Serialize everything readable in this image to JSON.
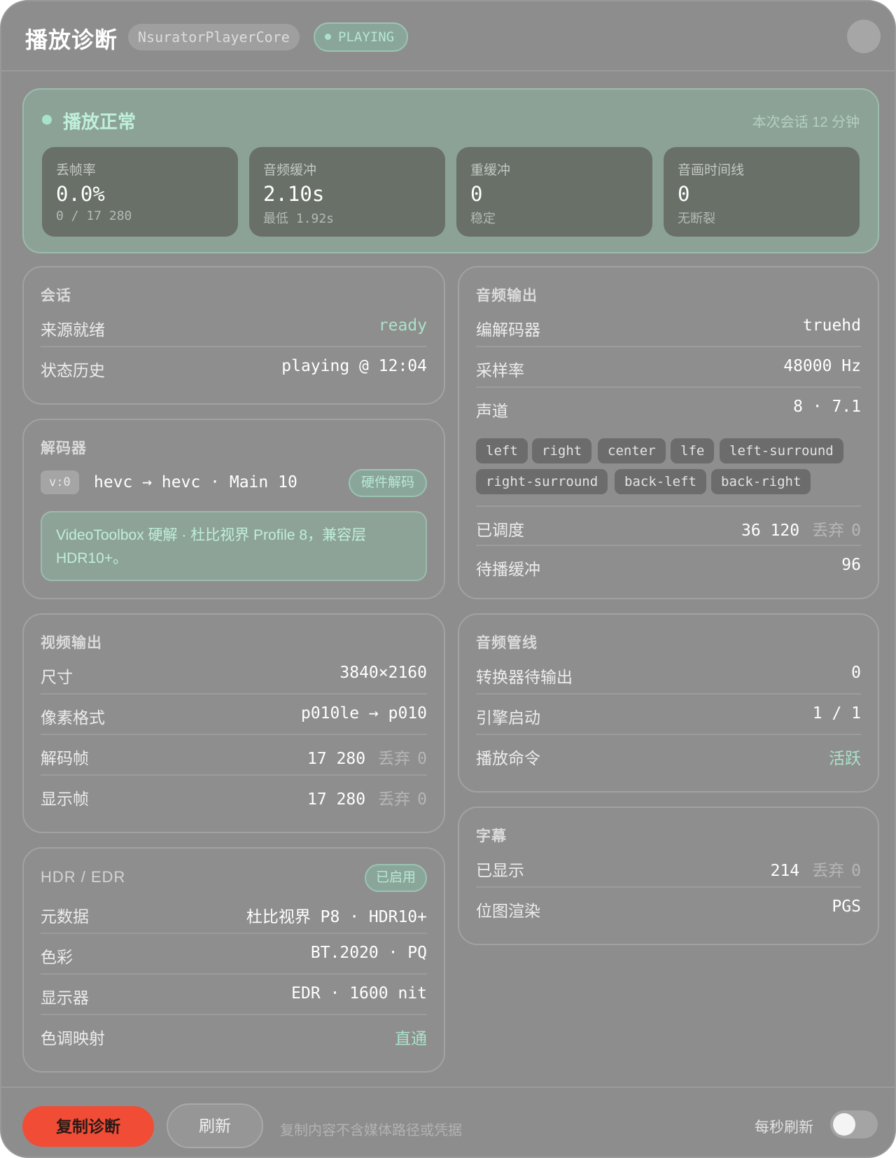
{
  "header": {
    "title": "播放诊断",
    "core": "NsuratorPlayerCore",
    "state": "PLAYING"
  },
  "status": {
    "title": "播放正常",
    "session": "本次会话 12 分钟",
    "metrics": [
      {
        "label": "丢帧率",
        "value": "0.0%",
        "sub": "0 / 17 280"
      },
      {
        "label": "音频缓冲",
        "value": "2.10s",
        "sub": "最低 1.92s"
      },
      {
        "label": "重缓冲",
        "value": "0",
        "sub": "稳定"
      },
      {
        "label": "音画时间线",
        "value": "0",
        "sub": "无断裂"
      }
    ]
  },
  "session": {
    "heading": "会话",
    "rows": [
      {
        "key": "来源就绪",
        "value": "ready"
      },
      {
        "key": "状态历史",
        "value": "playing @ 12:04"
      }
    ]
  },
  "decoder": {
    "heading": "解码器",
    "track": "v:0",
    "codec_line": "hevc → hevc · Main 10",
    "hw_label": "硬件解码",
    "note": "VideoToolbox 硬解 · 杜比视界 Profile 8，兼容层 HDR10+。"
  },
  "video_out": {
    "heading": "视频输出",
    "drop_label": "丢弃",
    "rows": [
      {
        "key": "尺寸",
        "value": "3840×2160"
      },
      {
        "key": "像素格式",
        "value": "p010le → p010"
      },
      {
        "key": "解码帧",
        "value": "17 280",
        "dropped": "0"
      },
      {
        "key": "显示帧",
        "value": "17 280",
        "dropped": "0"
      }
    ]
  },
  "hdr": {
    "heading": "HDR / EDR",
    "badge": "已启用",
    "rows": [
      {
        "key": "元数据",
        "value": "杜比视界 P8 · HDR10+"
      },
      {
        "key": "色彩",
        "value": "BT.2020 · PQ"
      },
      {
        "key": "显示器",
        "value": "EDR · 1600 nit"
      },
      {
        "key": "色调映射",
        "value": "直通"
      }
    ]
  },
  "audio_out": {
    "heading": "音频输出",
    "drop_label": "丢弃",
    "rows": [
      {
        "key": "编解码器",
        "value": "truehd"
      },
      {
        "key": "采样率",
        "value": "48000 Hz"
      },
      {
        "key": "声道",
        "value": "8 · 7.1"
      }
    ],
    "channels": [
      "left",
      "right",
      "center",
      "lfe",
      "left-surround",
      "right-surround",
      "back-left",
      "back-right"
    ],
    "rows2": [
      {
        "key": "已调度",
        "value": "36 120",
        "dropped": "0"
      },
      {
        "key": "待播缓冲",
        "value": "96"
      }
    ]
  },
  "audio_pipe": {
    "heading": "音频管线",
    "rows": [
      {
        "key": "转换器待输出",
        "value": "0"
      },
      {
        "key": "引擎启动",
        "value": "1 / 1"
      },
      {
        "key": "播放命令",
        "value": "活跃"
      }
    ]
  },
  "subtitles": {
    "heading": "字幕",
    "drop_label": "丢弃",
    "rows": [
      {
        "key": "已显示",
        "value": "214",
        "dropped": "0"
      },
      {
        "key": "位图渲染",
        "value": "PGS"
      }
    ]
  },
  "footer": {
    "copy_label": "复制诊断",
    "refresh_label": "刷新",
    "note": "复制内容不含媒体路径或凭据",
    "auto_label": "每秒刷新",
    "auto_refresh": false
  },
  "colors": {
    "accent": "#f14c35",
    "ok": "#a9e2c9",
    "panel": "#8f8e8e"
  }
}
